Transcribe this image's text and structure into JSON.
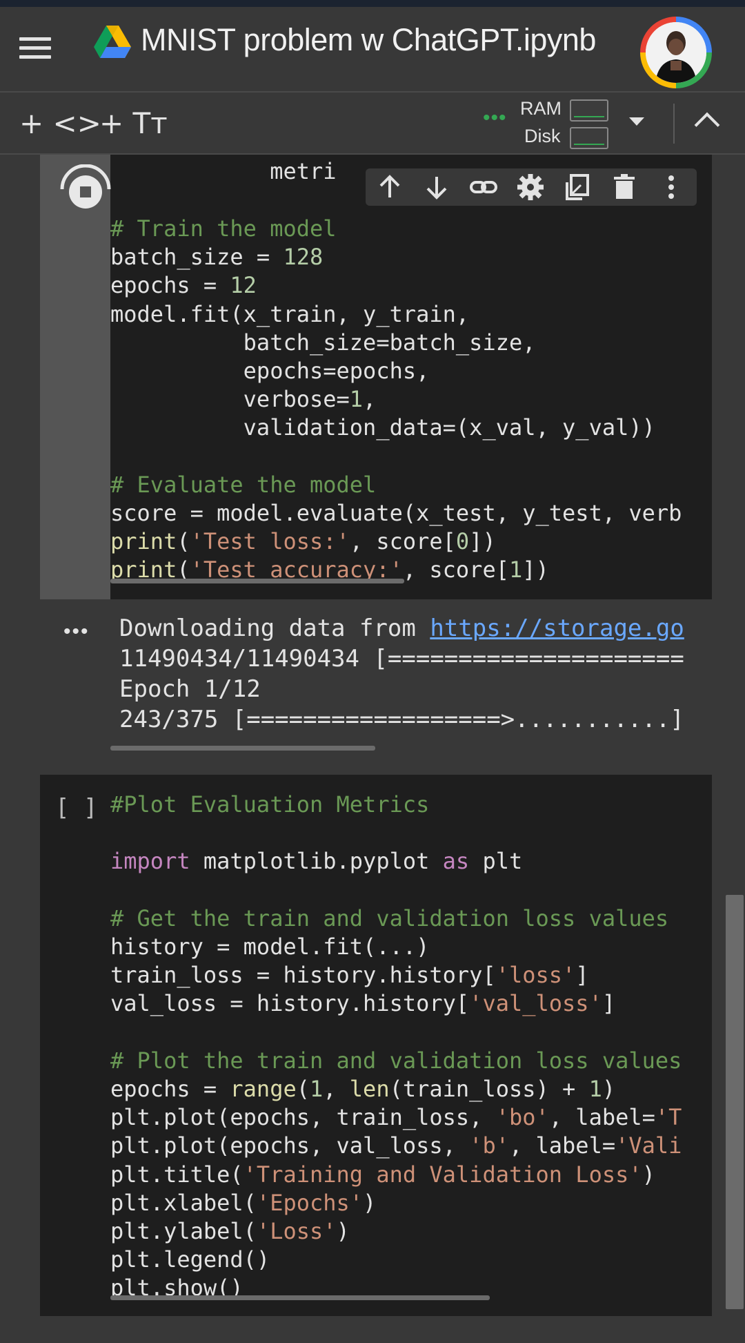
{
  "header": {
    "title": "MNIST problem w ChatGPT.ipynb"
  },
  "toolbar": {
    "add_code_label": "+ <>",
    "add_text_label": "+ Tт",
    "connected_dots": "•••",
    "ram_label": "RAM",
    "disk_label": "Disk"
  },
  "cell1": {
    "partial_line": "metri",
    "lines": [
      "# Train the model",
      "batch_size = 128",
      "epochs = 12",
      "model.fit(x_train, y_train,",
      "          batch_size=batch_size,",
      "          epochs=epochs,",
      "          verbose=1,",
      "          validation_data=(x_val, y_val))",
      "",
      "# Evaluate the model",
      "score = model.evaluate(x_test, y_test, verb",
      "print('Test loss:', score[0])",
      "print('Test accuracy:', score[1])"
    ]
  },
  "output": {
    "dots": "•••",
    "line1_prefix": "Downloading data from ",
    "line1_link": "https://storage.go",
    "line2": "11490434/11490434 [=====================",
    "line3": "Epoch 1/12",
    "line4": "243/375 [==================>...........]"
  },
  "cell2": {
    "bracket": "[ ]",
    "lines": [
      "#Plot Evaluation Metrics",
      "",
      "import matplotlib.pyplot as plt",
      "",
      "# Get the train and validation loss values",
      "history = model.fit(...)",
      "train_loss = history.history['loss']",
      "val_loss = history.history['val_loss']",
      "",
      "# Plot the train and validation loss values",
      "epochs = range(1, len(train_loss) + 1)",
      "plt.plot(epochs, train_loss, 'bo', label='T",
      "plt.plot(epochs, val_loss, 'b', label='Vali",
      "plt.title('Training and Validation Loss')",
      "plt.xlabel('Epochs')",
      "plt.ylabel('Loss')",
      "plt.legend()",
      "plt.show()"
    ]
  },
  "colors": {
    "comment": "#6a9955",
    "number": "#b5cea8",
    "string": "#ce9178",
    "keyword": "#c586c0",
    "function": "#dcdcaa",
    "link": "#6aa8ff"
  },
  "icons": [
    "menu-icon",
    "drive-icon",
    "stop-icon",
    "arrow-up-icon",
    "arrow-down-icon",
    "link-icon",
    "gear-icon",
    "mirror-cell-icon",
    "trash-icon",
    "more-vert-icon",
    "caret-down-icon",
    "chevron-up-icon"
  ]
}
